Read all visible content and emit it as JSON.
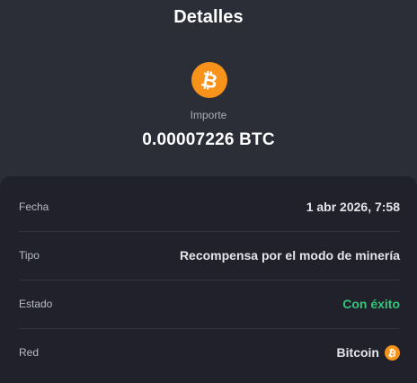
{
  "header": {
    "title": "Detalles"
  },
  "summary": {
    "icon": "bitcoin-icon",
    "amount_label": "Importe",
    "amount_value": "0.00007226 BTC"
  },
  "details": {
    "rows": [
      {
        "label": "Fecha",
        "value": "1 abr 2026, 7:58"
      },
      {
        "label": "Tipo",
        "value": "Recompensa por el modo de minería"
      },
      {
        "label": "Estado",
        "value": "Con éxito"
      },
      {
        "label": "Red",
        "value": "Bitcoin",
        "icon": "bitcoin-icon"
      }
    ]
  },
  "colors": {
    "background": "#2b2d37",
    "card": "#20212b",
    "bitcoin": "#f7931a",
    "success": "#35c47a"
  }
}
